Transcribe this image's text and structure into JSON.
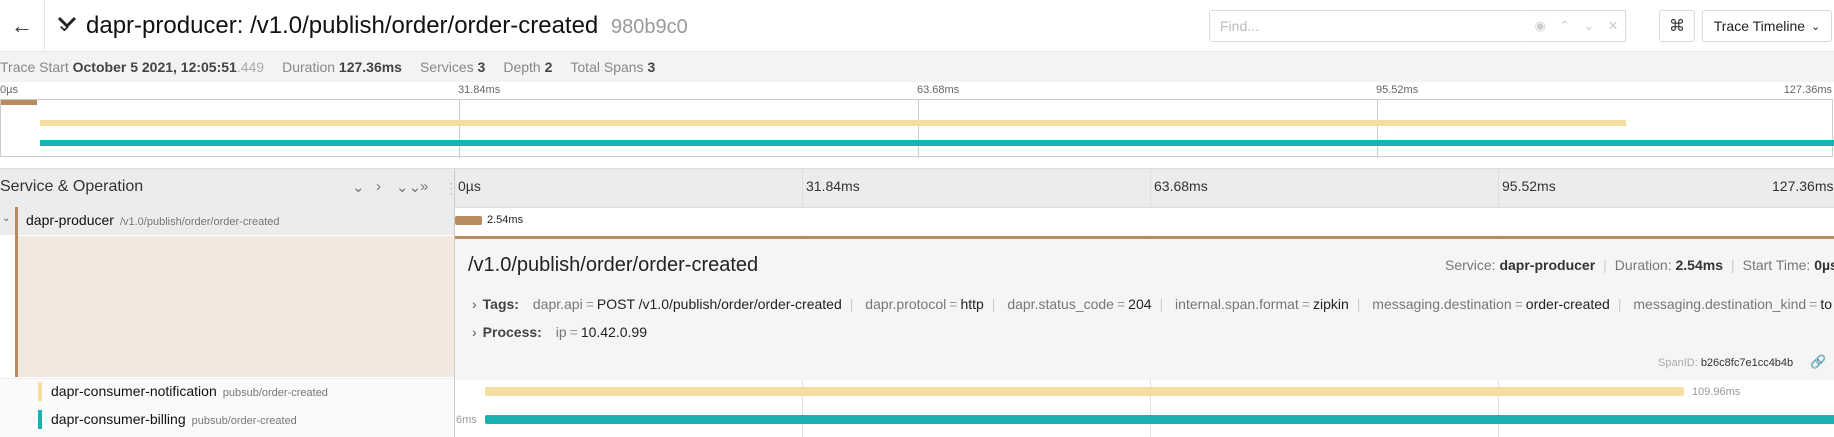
{
  "header": {
    "service": "dapr-producer:",
    "operation": "/v1.0/publish/order/order-created",
    "trace_id": "980b9c0",
    "find_placeholder": "Find...",
    "view_label": "Trace Timeline"
  },
  "meta": {
    "start_label": "Trace Start",
    "start_value": "October 5 2021, 12:05:51",
    "start_ms": ".449",
    "duration_label": "Duration",
    "duration_value": "127.36ms",
    "services_label": "Services",
    "services_value": "3",
    "depth_label": "Depth",
    "depth_value": "2",
    "spans_label": "Total Spans",
    "spans_value": "3"
  },
  "ticks": [
    "0µs",
    "31.84ms",
    "63.68ms",
    "95.52ms",
    "127.36ms"
  ],
  "columns": {
    "service_operation": "Service & Operation"
  },
  "spans": [
    {
      "service": "dapr-producer",
      "operation": "/v1.0/publish/order/order-created",
      "duration_label": "2.54ms",
      "color": "#b88a5f",
      "start_frac": 0.0,
      "end_frac": 0.02
    },
    {
      "service": "dapr-consumer-notification",
      "operation": "pubsub/order-created",
      "duration_label": "109.96ms",
      "color": "#f4dea2",
      "start_frac": 0.02,
      "end_frac": 0.89
    },
    {
      "service": "dapr-consumer-billing",
      "operation": "pubsub/order-created",
      "duration_label": "6ms",
      "color": "#18b2b2",
      "start_frac": 0.02,
      "end_frac": 1.0
    }
  ],
  "detail": {
    "title": "/v1.0/publish/order/order-created",
    "service_label": "Service:",
    "service_value": "dapr-producer",
    "duration_label": "Duration:",
    "duration_value": "2.54ms",
    "start_label": "Start Time:",
    "start_value": "0µs",
    "tags_label": "Tags:",
    "tags": [
      {
        "k": "dapr.api",
        "v": "POST /v1.0/publish/order/order-created"
      },
      {
        "k": "dapr.protocol",
        "v": "http"
      },
      {
        "k": "dapr.status_code",
        "v": "204"
      },
      {
        "k": "internal.span.format",
        "v": "zipkin"
      },
      {
        "k": "messaging.destination",
        "v": "order-created"
      },
      {
        "k": "messaging.destination_kind",
        "v": "top…"
      }
    ],
    "process_label": "Process:",
    "process": [
      {
        "k": "ip",
        "v": "10.42.0.99"
      }
    ],
    "span_id_label": "SpanID:",
    "span_id_value": "b26c8fc7e1cc4b4b"
  },
  "colors": {
    "producer": "#b88a5f",
    "notification": "#f4dea2",
    "billing": "#18b2b2"
  }
}
